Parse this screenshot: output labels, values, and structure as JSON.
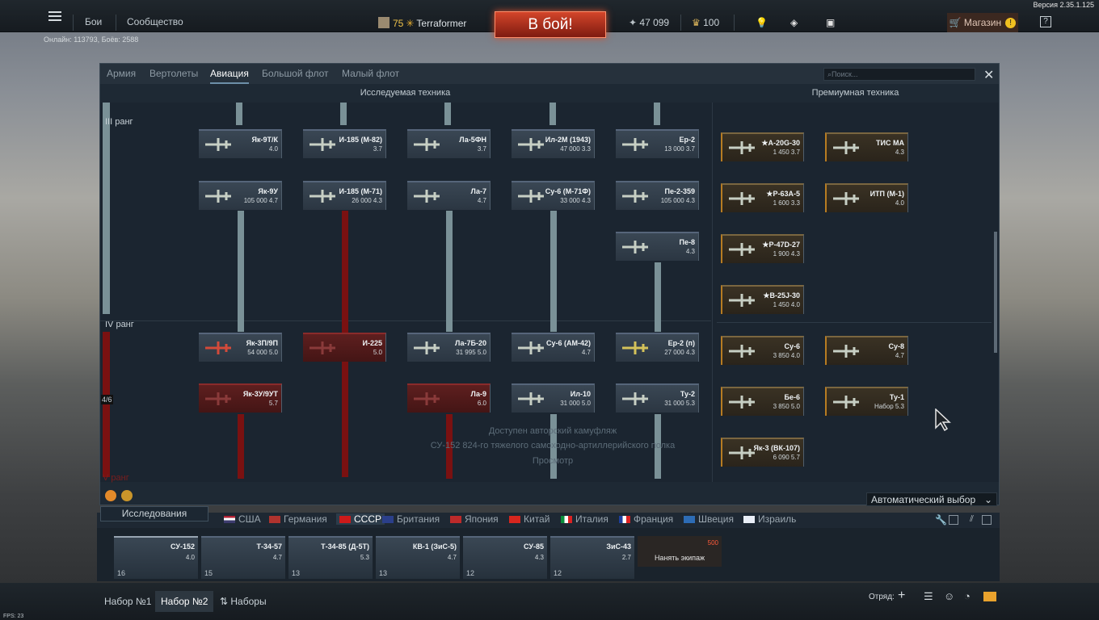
{
  "version": "Версия 2.35.1.125",
  "top_nav": {
    "battles": "Бои",
    "community": "Сообщество"
  },
  "online": "Онлайн: 113793, Боёв: 2588",
  "player": {
    "level": "75",
    "name": "Terraformer"
  },
  "battle_button": "В бой!",
  "resources": {
    "silver": "47 099",
    "gold": "100"
  },
  "shop": "Магазин",
  "help": "?",
  "tabs": [
    "Армия",
    "Вертолеты",
    "Авиация",
    "Большой флот",
    "Малый флот"
  ],
  "active_tab": "Авиация",
  "search_placeholder": "Поиск...",
  "sections": {
    "researched": "Исследуемая техника",
    "premium": "Премиумная техника"
  },
  "ranks": {
    "r3": "III ранг",
    "r4": "IV ранг",
    "r5": "V ранг",
    "progress": "4/6"
  },
  "tree": {
    "r3": [
      {
        "name": "Як-9Т/К",
        "stat": "4.0"
      },
      {
        "name": "И-185 (М-82)",
        "stat": "3.7"
      },
      {
        "name": "Ла-5ФН",
        "stat": "3.7"
      },
      {
        "name": "Ил-2М (1943)",
        "stat": "47 000  3.3"
      },
      {
        "name": "Ер-2",
        "stat": "13 000  3.7"
      },
      {
        "name": "Як-9У",
        "stat": "105 000  4.7"
      },
      {
        "name": "И-185 (М-71)",
        "stat": "26 000  4.3"
      },
      {
        "name": "Ла-7",
        "stat": "4.7"
      },
      {
        "name": "Су-6 (М-71Ф)",
        "stat": "33 000  4.3"
      },
      {
        "name": "Пе-2-359",
        "stat": "105 000  4.3"
      },
      {
        "name": "Пе-8",
        "stat": "4.3"
      }
    ],
    "r4": [
      {
        "name": "Як-3П/9П",
        "stat": "54 000  5.0"
      },
      {
        "name": "И-225",
        "stat": "5.0"
      },
      {
        "name": "Ла-7Б-20",
        "stat": "31 995  5.0"
      },
      {
        "name": "Су-6 (АМ-42)",
        "stat": "4.7"
      },
      {
        "name": "Ер-2 (п)",
        "stat": "27 000  4.3"
      },
      {
        "name": "Як-3У/9УТ",
        "stat": "5.7"
      },
      {
        "name": "Ла-9",
        "stat": "6.0"
      },
      {
        "name": "Ил-10",
        "stat": "31 000  5.0"
      },
      {
        "name": "Ту-2",
        "stat": "31 000  5.3"
      }
    ],
    "premium": [
      {
        "name": "★A-20G-30",
        "stat": "1 450  3.7"
      },
      {
        "name": "ТИС МА",
        "stat": "4.3"
      },
      {
        "name": "★P-63A-5",
        "stat": "1 600  3.3"
      },
      {
        "name": "ИТП (М-1)",
        "stat": "4.0"
      },
      {
        "name": "★P-47D-27",
        "stat": "1 900  4.3"
      },
      {
        "name": "★B-25J-30",
        "stat": "1 450  4.0"
      },
      {
        "name": "Су-6",
        "stat": "3 850  4.0"
      },
      {
        "name": "Су-8",
        "stat": "4.7"
      },
      {
        "name": "Бе-6",
        "stat": "3 850  5.0"
      },
      {
        "name": "Ту-1",
        "stat": "Набор 5.3"
      },
      {
        "name": "Як-3 (ВК-107)",
        "stat": "6 090  5.7"
      }
    ]
  },
  "camo_note": {
    "line1": "Доступен авторский камуфляж",
    "line2": "СУ-152 824-го тяжелого самоходно-артиллерийского полка",
    "line3": "Просмотр"
  },
  "auto_select": "Автоматический выбор",
  "research_tab": "Исследования",
  "nations": [
    "США",
    "Германия",
    "СССР",
    "Британия",
    "Япония",
    "Китай",
    "Италия",
    "Франция",
    "Швеция",
    "Израиль"
  ],
  "active_nation": "СССР",
  "crew_slots": [
    {
      "name": "СУ-152",
      "stat": "4.0",
      "level": "16"
    },
    {
      "name": "Т-34-57",
      "stat": "4.7",
      "level": "15"
    },
    {
      "name": "Т-34-85 (Д-5Т)",
      "stat": "5.3",
      "level": "13"
    },
    {
      "name": "КВ-1 (ЗиС-5)",
      "stat": "4.7",
      "level": "13"
    },
    {
      "name": "СУ-85",
      "stat": "4.3",
      "level": "12"
    },
    {
      "name": "ЗиС-43",
      "stat": "2.7",
      "level": "12"
    }
  ],
  "hire_crew": {
    "label": "Нанять экипаж",
    "cost": "500"
  },
  "presets": {
    "p1": "Набор №1",
    "p2": "Набор №2",
    "all": "Наборы"
  },
  "squad": "Отряд:",
  "fps": "FPS: 23"
}
